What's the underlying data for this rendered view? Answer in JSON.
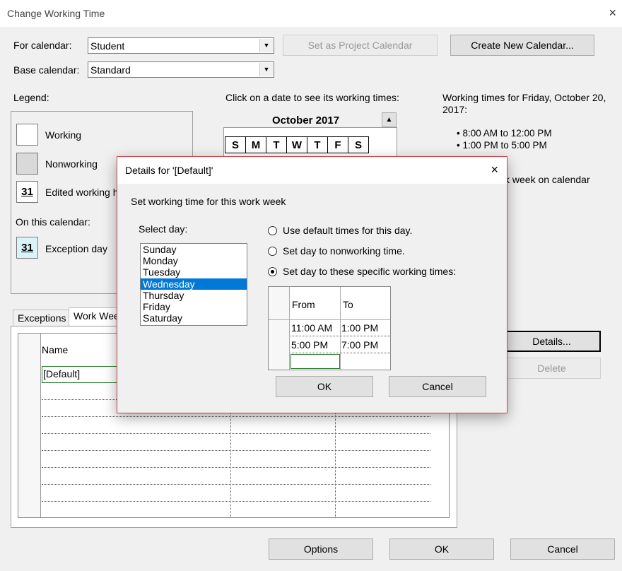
{
  "window": {
    "title": "Change Working Time",
    "close_icon": "×"
  },
  "for_calendar": {
    "label": "For calendar:",
    "value": "Student"
  },
  "base_calendar": {
    "label": "Base calendar:",
    "value": "Standard"
  },
  "buttons": {
    "set_project_calendar": "Set as Project Calendar",
    "create_new_calendar": "Create New Calendar...",
    "details": "Details...",
    "delete": "Delete",
    "options": "Options",
    "ok": "OK",
    "cancel": "Cancel"
  },
  "legend": {
    "title": "Legend:",
    "working": "Working",
    "nonworking": "Nonworking",
    "edited": "Edited working hours",
    "edited_num": "31",
    "on_this_calendar": "On this calendar:",
    "exception": "Exception day",
    "exception_num": "31"
  },
  "calendar": {
    "instruction": "Click on a date to see its working times:",
    "month": "October 2017",
    "days": [
      "S",
      "M",
      "T",
      "W",
      "T",
      "F",
      "S"
    ]
  },
  "working_times": {
    "heading": "Working times for Friday, October 20, 2017:",
    "items": [
      "8:00 AM to 12:00 PM",
      "1:00 PM to 5:00 PM"
    ],
    "fragment": "k week on calendar"
  },
  "tabs": {
    "exceptions": "Exceptions",
    "work_weeks": "Work Weeks"
  },
  "table": {
    "name_header": "Name",
    "first_row": "[Default]"
  },
  "dialog": {
    "title": "Details for '[Default]'",
    "subtitle": "Set working time for this work week",
    "select_day_label": "Select day:",
    "days": [
      "Sunday",
      "Monday",
      "Tuesday",
      "Wednesday",
      "Thursday",
      "Friday",
      "Saturday"
    ],
    "selected_day": "Wednesday",
    "options": {
      "default": "Use default times for this day.",
      "nonworking": "Set day to nonworking time.",
      "specific": "Set day to these specific working times:"
    },
    "selected_option": "specific",
    "times_header": {
      "from": "From",
      "to": "To"
    },
    "times": [
      {
        "from": "11:00 AM",
        "to": "1:00 PM"
      },
      {
        "from": "5:00 PM",
        "to": "7:00 PM"
      }
    ],
    "ok": "OK",
    "cancel": "Cancel"
  }
}
